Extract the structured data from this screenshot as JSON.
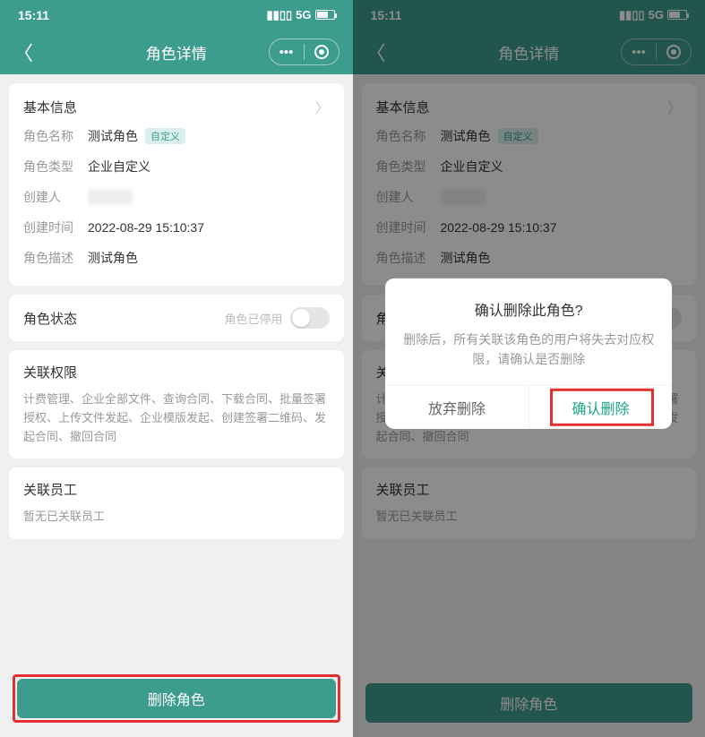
{
  "statusBar": {
    "time": "15:11",
    "net": "5G"
  },
  "nav": {
    "title": "角色详情"
  },
  "sections": {
    "basic": {
      "header": "基本信息",
      "nameLabel": "角色名称",
      "nameValue": "测试角色",
      "nameBadge": "自定义",
      "typeLabel": "角色类型",
      "typeValue": "企业自定义",
      "creatorLabel": "创建人",
      "createdLabel": "创建时间",
      "createdValue": "2022-08-29 15:10:37",
      "descLabel": "角色描述",
      "descValue": "测试角色"
    },
    "status": {
      "label": "角色状态",
      "disabledText": "角色已停用"
    },
    "perms": {
      "title": "关联权限",
      "text": "计费管理、企业全部文件、查询合同、下载合同、批量签署授权、上传文件发起、企业模版发起、创建签署二维码、发起合同、撤回合同"
    },
    "staff": {
      "title": "关联员工",
      "text": "暂无已关联员工"
    }
  },
  "deleteBtn": "删除角色",
  "dialog": {
    "title": "确认删除此角色?",
    "message": "删除后，所有关联该角色的用户将失去对应权限，请确认是否删除",
    "cancel": "放弃删除",
    "confirm": "确认删除"
  }
}
